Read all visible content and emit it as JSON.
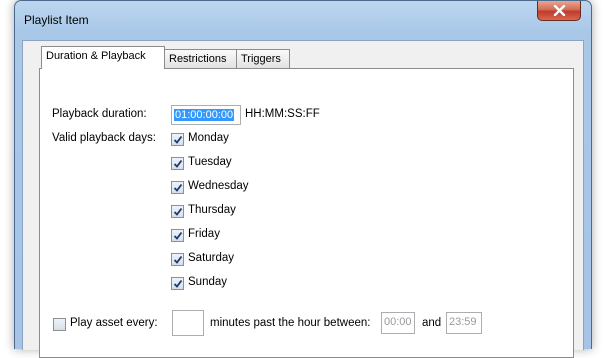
{
  "window": {
    "title": "Playlist Item"
  },
  "tabs": [
    {
      "label": "Duration & Playback"
    },
    {
      "label": "Restrictions"
    },
    {
      "label": "Triggers"
    }
  ],
  "duration": {
    "label": "Playback duration:",
    "value": "01:00:00:00",
    "format": "HH:MM:SS:FF"
  },
  "days": {
    "label": "Valid playback days:",
    "items": [
      {
        "label": "Monday",
        "checked": true
      },
      {
        "label": "Tuesday",
        "checked": true
      },
      {
        "label": "Wednesday",
        "checked": true
      },
      {
        "label": "Thursday",
        "checked": true
      },
      {
        "label": "Friday",
        "checked": true
      },
      {
        "label": "Saturday",
        "checked": true
      },
      {
        "label": "Sunday",
        "checked": true
      }
    ]
  },
  "play_every": {
    "label": "Play asset every:",
    "checked": false,
    "minutes_value": "",
    "between_label": "minutes past the hour between:",
    "start_time": "00:00",
    "and_label": "and",
    "end_time": "23:59"
  }
}
